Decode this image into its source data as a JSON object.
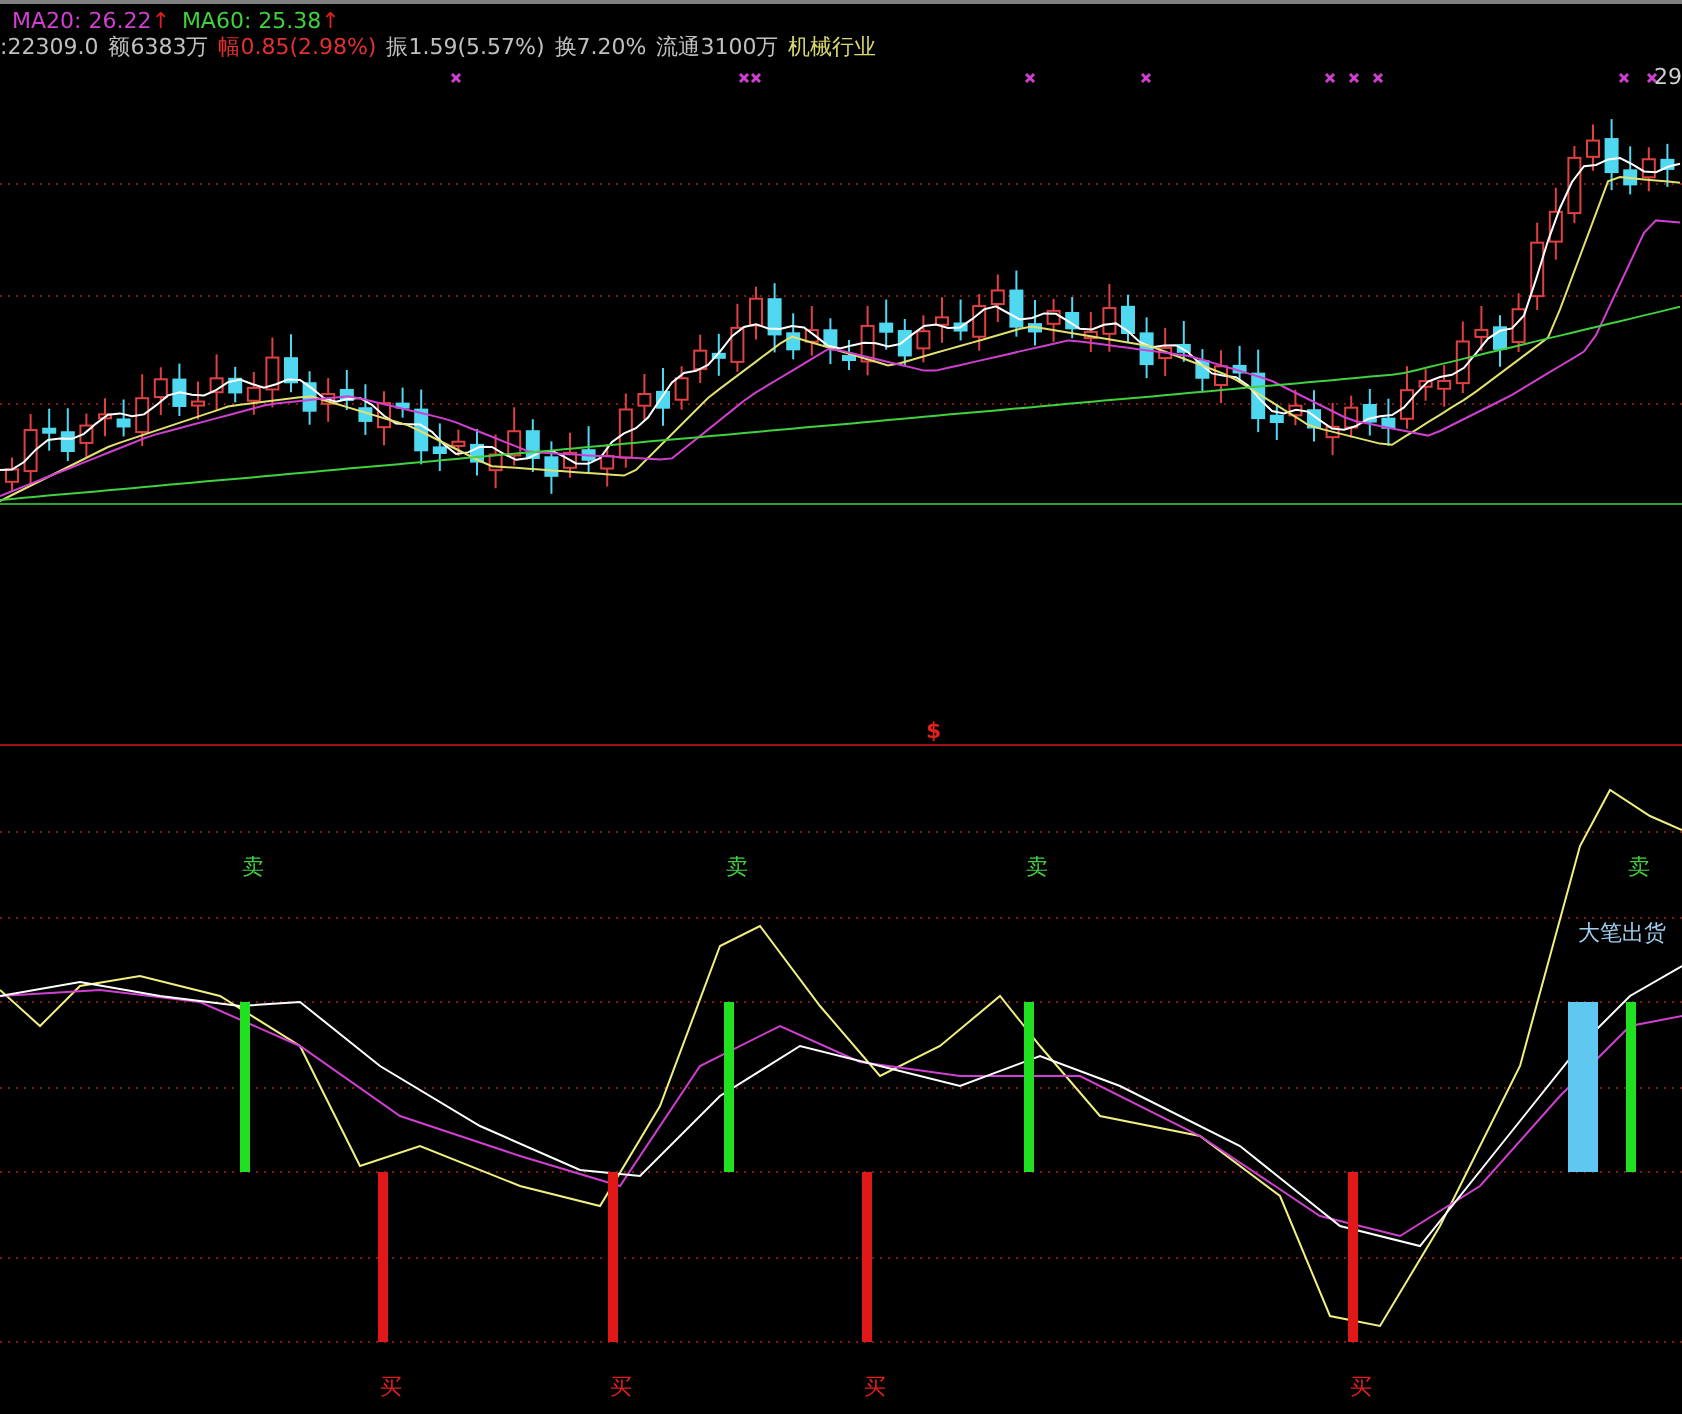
{
  "header": {
    "ma_lines": [
      {
        "label": "MA20: 26.22",
        "trend": "↑",
        "color": "#d040d0"
      },
      {
        "label": "MA60: 25.38",
        "trend": "↑",
        "color": "#40d040"
      }
    ],
    "stats": [
      {
        "text": ":22309.0",
        "color": "#c0c0c0"
      },
      {
        "text": "额6383万",
        "color": "#c0c0c0"
      },
      {
        "text": "幅0.85(2.98%)",
        "color": "#e03030"
      },
      {
        "text": "振1.59(5.57%)",
        "color": "#c0c0c0"
      },
      {
        "text": "换7.20%",
        "color": "#c0c0c0"
      },
      {
        "text": "流通3100万",
        "color": "#c0c0c0"
      },
      {
        "text": "机械行业",
        "color": "#d8d870"
      }
    ]
  },
  "price_chart": {
    "price_label": "29"
  },
  "divider": {
    "marker": "$"
  },
  "signals": [
    {
      "kind": "sell",
      "label": "卖"
    },
    {
      "kind": "buy",
      "label": "买"
    },
    {
      "kind": "buy",
      "label": "买"
    },
    {
      "kind": "sell",
      "label": "卖"
    },
    {
      "kind": "buy",
      "label": "买"
    },
    {
      "kind": "sell",
      "label": "卖"
    },
    {
      "kind": "buy",
      "label": "买"
    },
    {
      "kind": "big_sell",
      "label": "大笔出货"
    },
    {
      "kind": "sell",
      "label": "卖"
    }
  ]
}
